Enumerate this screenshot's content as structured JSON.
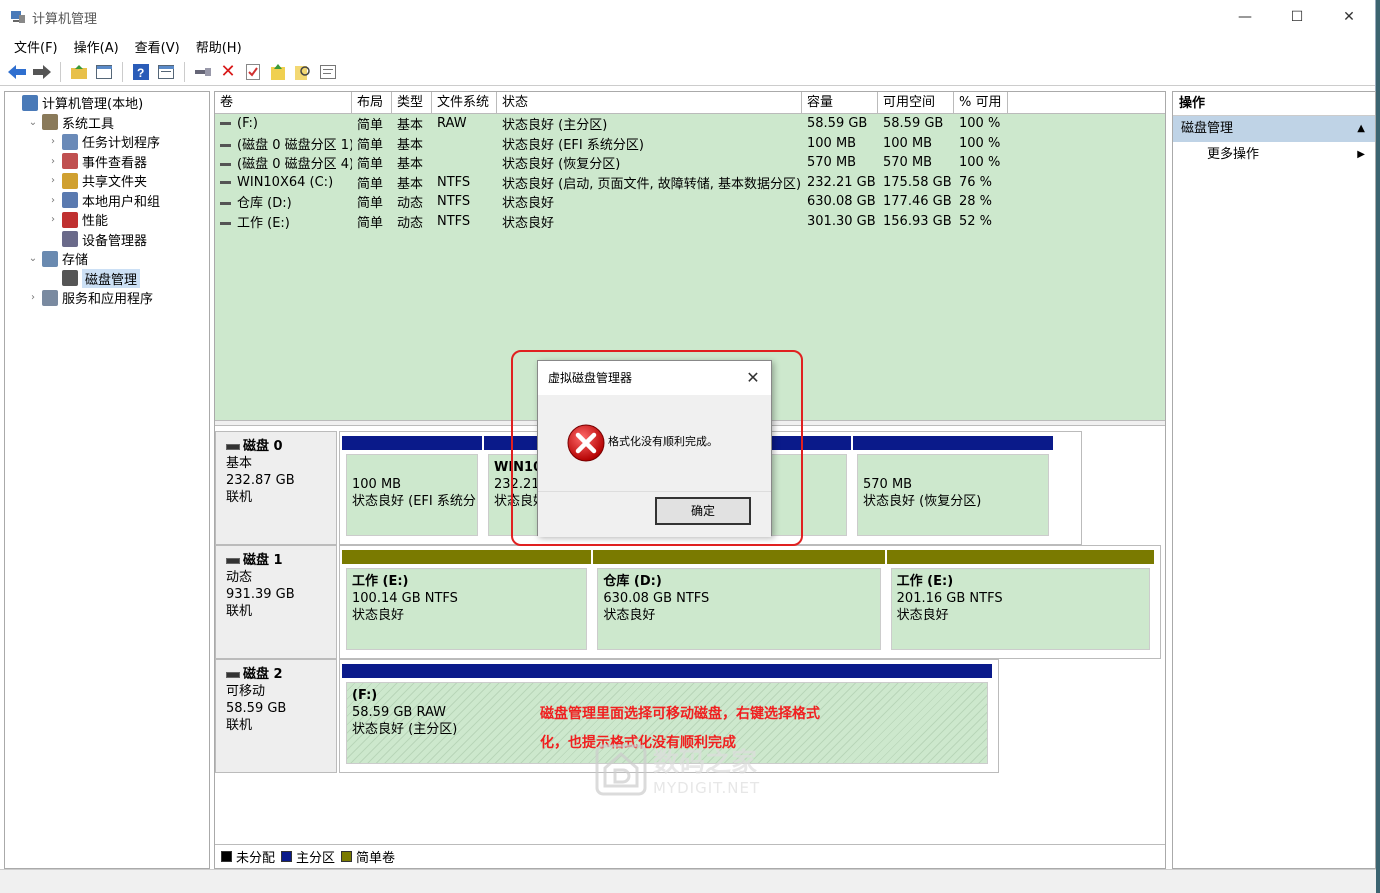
{
  "window": {
    "title": "计算机管理"
  },
  "menu": [
    "文件(F)",
    "操作(A)",
    "查看(V)",
    "帮助(H)"
  ],
  "toolbar_icons": [
    "back-icon",
    "forward-icon",
    "up-folder-icon",
    "show-tree-icon",
    "help-icon",
    "view-icon",
    "connect-icon",
    "delete-icon",
    "check-icon",
    "import-icon",
    "search-icon",
    "properties-icon"
  ],
  "tree": [
    {
      "label": "计算机管理(本地)",
      "indent": 0,
      "arrow": "",
      "icon": "computer-icon"
    },
    {
      "label": "系统工具",
      "indent": 1,
      "arrow": "⌄",
      "icon": "tools-icon"
    },
    {
      "label": "任务计划程序",
      "indent": 2,
      "arrow": "›",
      "icon": "clock-icon"
    },
    {
      "label": "事件查看器",
      "indent": 2,
      "arrow": "›",
      "icon": "event-icon"
    },
    {
      "label": "共享文件夹",
      "indent": 2,
      "arrow": "›",
      "icon": "share-icon"
    },
    {
      "label": "本地用户和组",
      "indent": 2,
      "arrow": "›",
      "icon": "users-icon"
    },
    {
      "label": "性能",
      "indent": 2,
      "arrow": "›",
      "icon": "performance-icon"
    },
    {
      "label": "设备管理器",
      "indent": 2,
      "arrow": "",
      "icon": "device-icon"
    },
    {
      "label": "存储",
      "indent": 1,
      "arrow": "⌄",
      "icon": "storage-icon"
    },
    {
      "label": "磁盘管理",
      "indent": 2,
      "arrow": "",
      "icon": "disk-icon",
      "selected": true
    },
    {
      "label": "服务和应用程序",
      "indent": 1,
      "arrow": "›",
      "icon": "services-icon"
    }
  ],
  "volume_columns": [
    "卷",
    "布局",
    "类型",
    "文件系统",
    "状态",
    "容量",
    "可用空间",
    "% 可用"
  ],
  "volumes": [
    [
      "(F:)",
      "简单",
      "基本",
      "RAW",
      "状态良好 (主分区)",
      "58.59 GB",
      "58.59 GB",
      "100 %"
    ],
    [
      "(磁盘 0 磁盘分区 1)",
      "简单",
      "基本",
      "",
      "状态良好 (EFI 系统分区)",
      "100 MB",
      "100 MB",
      "100 %"
    ],
    [
      "(磁盘 0 磁盘分区 4)",
      "简单",
      "基本",
      "",
      "状态良好 (恢复分区)",
      "570 MB",
      "570 MB",
      "100 %"
    ],
    [
      "WIN10X64 (C:)",
      "简单",
      "基本",
      "NTFS",
      "状态良好 (启动, 页面文件, 故障转储, 基本数据分区)",
      "232.21 GB",
      "175.58 GB",
      "76 %"
    ],
    [
      "仓库 (D:)",
      "简单",
      "动态",
      "NTFS",
      "状态良好",
      "630.08 GB",
      "177.46 GB",
      "28 %"
    ],
    [
      "工作 (E:)",
      "简单",
      "动态",
      "NTFS",
      "状态良好",
      "301.30 GB",
      "156.93 GB",
      "52 %"
    ]
  ],
  "disks": [
    {
      "name": "磁盘 0",
      "type": "基本",
      "size": "232.87 GB",
      "status": "联机",
      "partitions": [
        {
          "title": "",
          "line1": "100 MB",
          "line2": "状态良好 (EFI 系统分区)",
          "bar": "#0a1a8a"
        },
        {
          "title": "WIN10",
          "line1": "232.21",
          "line2": "状态良好",
          "bar": "#0a1a8a"
        },
        {
          "title": "",
          "line1": "",
          "line2": "区)",
          "bar": "#0a1a8a"
        },
        {
          "title": "",
          "line1": "570 MB",
          "line2": "状态良好 (恢复分区)",
          "bar": "#0a1a8a"
        }
      ]
    },
    {
      "name": "磁盘 1",
      "type": "动态",
      "size": "931.39 GB",
      "status": "联机",
      "partitions": [
        {
          "title": "工作 (E:)",
          "line1": "100.14 GB NTFS",
          "line2": "状态良好",
          "bar": "#7a7a00"
        },
        {
          "title": "仓库 (D:)",
          "line1": "630.08 GB NTFS",
          "line2": "状态良好",
          "bar": "#7a7a00"
        },
        {
          "title": "工作 (E:)",
          "line1": "201.16 GB NTFS",
          "line2": "状态良好",
          "bar": "#7a7a00"
        }
      ]
    },
    {
      "name": "磁盘 2",
      "type": "可移动",
      "size": "58.59 GB",
      "status": "联机",
      "partitions": [
        {
          "title": "(F:)",
          "line1": "58.59 GB RAW",
          "line2": "状态良好 (主分区)",
          "bar": "#0a1a8a"
        }
      ]
    }
  ],
  "legend": [
    {
      "label": "未分配",
      "color": "#000000"
    },
    {
      "label": "主分区",
      "color": "#0a1a8a"
    },
    {
      "label": "简单卷",
      "color": "#7a7a00"
    }
  ],
  "actions": {
    "header": "操作",
    "section": "磁盘管理",
    "item": "更多操作"
  },
  "dialog": {
    "title": "虚拟磁盘管理器",
    "message": "格式化没有顺利完成。",
    "ok": "确定"
  },
  "annotation": {
    "line1": "磁盘管理里面选择可移动磁盘，右键选择格式",
    "line2": "化，也提示格式化没有顺利完成"
  },
  "watermark": {
    "text": "数码之家",
    "sub": "MYDIGIT.NET"
  },
  "colors": {
    "healthy_fill": "#cde8cd",
    "primary": "#0a1a8a",
    "simple": "#7a7a00",
    "accent_red": "#e02020"
  }
}
